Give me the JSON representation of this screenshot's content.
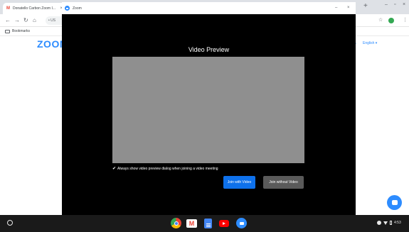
{
  "browser": {
    "tab_title": "Donatello Carbon Zoom I...",
    "tab_close": "×",
    "new_tab": "+",
    "window_min": "–",
    "window_max": "▫",
    "window_close": "×",
    "omnibox_text": "US",
    "bookmarks_label": "Bookmarks"
  },
  "page": {
    "logo": "ZOOM",
    "language": "English ▾",
    "language_icon": "•"
  },
  "zoom_window": {
    "title": "Zoom",
    "min": "–",
    "close": "×",
    "heading": "Video Preview",
    "checkbox_mark": "✔",
    "checkbox_label": "Always show video preview dialog when joining a video meeting",
    "join_with_video": "Join with Video",
    "join_without_video": "Join without Video",
    "preview_color": "#8f8f8f",
    "primary_color": "#0e71eb"
  },
  "shelf": {
    "apps": [
      "chrome",
      "gmail",
      "docs",
      "youtube",
      "zoom"
    ],
    "gmail_glyph": "M",
    "time": "4:53"
  },
  "colors": {
    "zoom_blue": "#2d8cff",
    "shelf_bg": "#1a1a1a"
  }
}
